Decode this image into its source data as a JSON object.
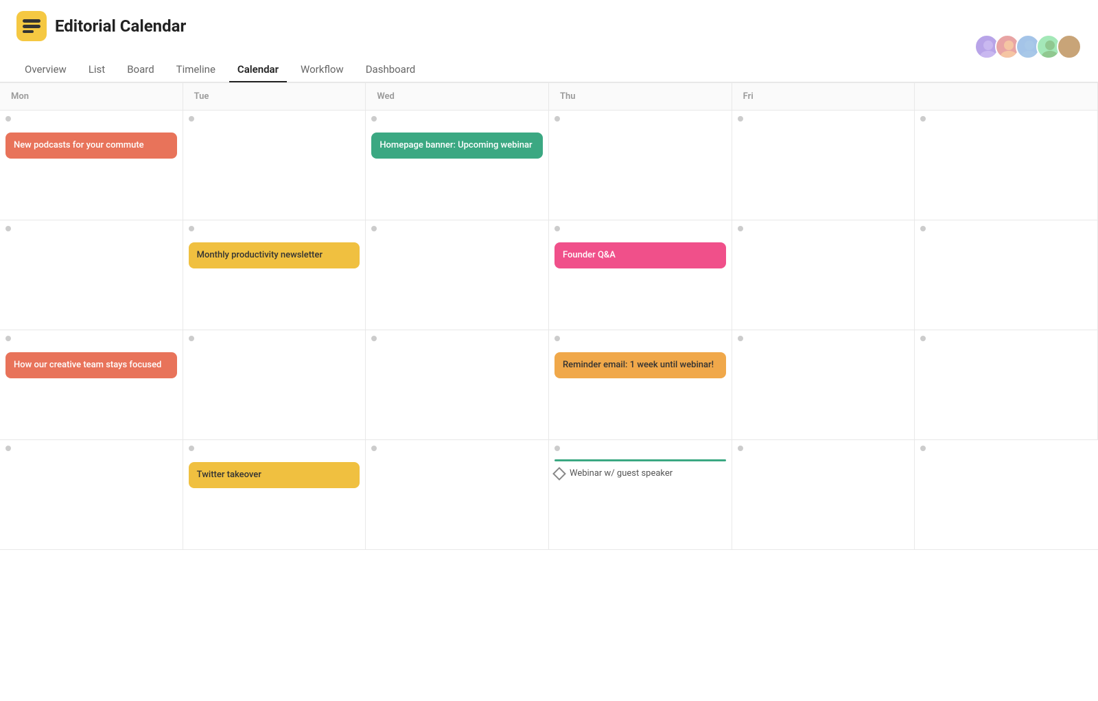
{
  "app": {
    "title": "Editorial Calendar",
    "logo_alt": "app-logo"
  },
  "nav": {
    "items": [
      {
        "id": "overview",
        "label": "Overview",
        "active": false
      },
      {
        "id": "list",
        "label": "List",
        "active": false
      },
      {
        "id": "board",
        "label": "Board",
        "active": false
      },
      {
        "id": "timeline",
        "label": "Timeline",
        "active": false
      },
      {
        "id": "calendar",
        "label": "Calendar",
        "active": true
      },
      {
        "id": "workflow",
        "label": "Workflow",
        "active": false
      },
      {
        "id": "dashboard",
        "label": "Dashboard",
        "active": false
      }
    ]
  },
  "calendar": {
    "days": [
      "Mon",
      "Tue",
      "Wed",
      "Thu",
      "Fri",
      ""
    ],
    "events": {
      "row1": {
        "mon": {
          "label": "New podcasts for your commute",
          "color": "salmon"
        },
        "wed": {
          "label": "Homepage banner: Upcoming webinar",
          "color": "green"
        }
      },
      "row2": {
        "tue": {
          "label": "Monthly productivity newsletter",
          "color": "yellow"
        },
        "thu": {
          "label": "Founder Q&A",
          "color": "pink"
        }
      },
      "row3": {
        "mon": {
          "label": "How our creative team stays focused",
          "color": "salmon"
        },
        "thu": {
          "label": "Reminder email: 1 week until webinar!",
          "color": "orange-light"
        }
      },
      "row4": {
        "tue": {
          "label": "Twitter takeover",
          "color": "yellow"
        },
        "thu_diamond": {
          "label": "Webinar w/ guest speaker"
        }
      }
    }
  },
  "avatars": [
    {
      "id": "av1",
      "name": "User 1"
    },
    {
      "id": "av2",
      "name": "User 2"
    },
    {
      "id": "av3",
      "name": "User 3"
    },
    {
      "id": "av4",
      "name": "User 4"
    },
    {
      "id": "av5",
      "name": "User 5"
    }
  ]
}
